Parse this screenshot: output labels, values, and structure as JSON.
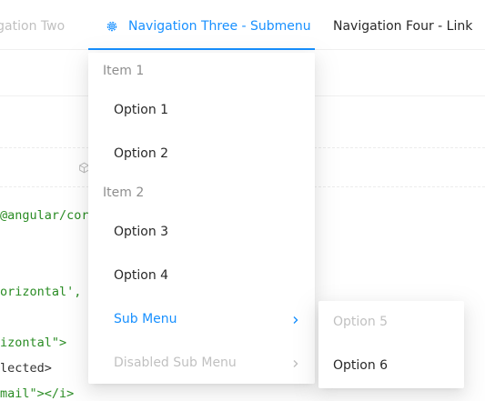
{
  "topnav": {
    "item_two": "vigation Two",
    "item_three": "Navigation Three - Submenu",
    "item_three_icon": "setting-icon",
    "item_four": "Navigation Four - Link",
    "accent_color": "#1890ff"
  },
  "background": {
    "code_lines": [
      {
        "text": "@angular/cor",
        "color": "green"
      },
      {
        "text": "orizontal',",
        "color": "mixed"
      },
      {
        "text": "izontal\">",
        "color": "mixed"
      },
      {
        "text": "lected>",
        "color": "mixed"
      },
      {
        "text": "mail\"></i>",
        "color": "mixed"
      }
    ],
    "box_icon": "code-sandbox-icon"
  },
  "dropdown": {
    "group1_title": "Item 1",
    "group1_options": [
      "Option 1",
      "Option 2"
    ],
    "group2_title": "Item 2",
    "group2_options": [
      "Option 3",
      "Option 4"
    ],
    "submenu_label": "Sub Menu",
    "disabled_submenu_label": "Disabled Sub Menu"
  },
  "submenu_popup": {
    "options": [
      "Option 5",
      "Option 6"
    ],
    "option5_disabled": true
  }
}
